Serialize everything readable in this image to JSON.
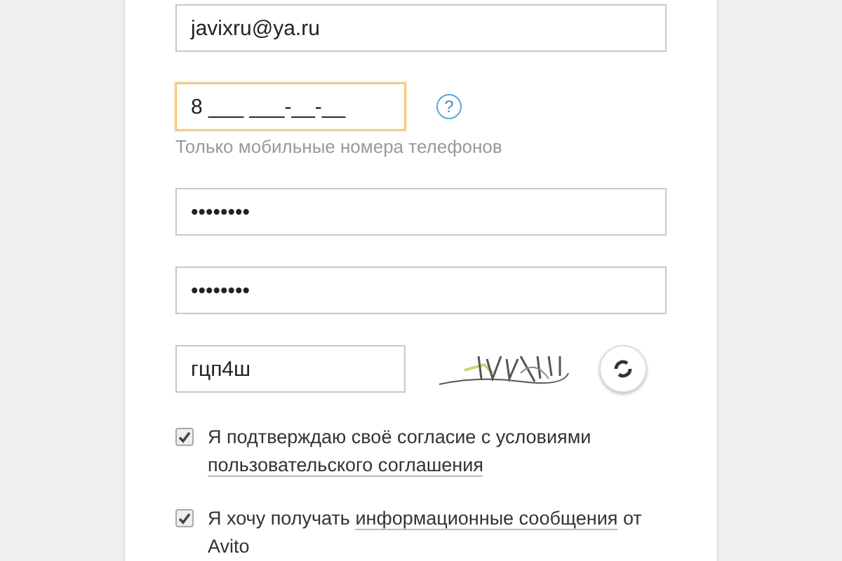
{
  "fields": [
    {
      "kind": "text",
      "value": "javixru@ya.ru",
      "focused": false
    },
    {
      "kind": "phone",
      "value": "8 ___ ___-__-__",
      "focused": true,
      "help": "?",
      "hint": "Только мобильные номера телефонов"
    },
    {
      "kind": "text",
      "value": "••••••••",
      "focused": false
    },
    {
      "kind": "text",
      "value": "••••••••",
      "focused": false
    }
  ],
  "captcha": {
    "value": "гцп4ш"
  },
  "agreements": [
    {
      "checked": true,
      "parts": [
        {
          "text": "Я подтверждаю своё согласие с условиями ",
          "link": false
        },
        {
          "text": "пользовательского соглашения",
          "link": true
        }
      ]
    },
    {
      "checked": true,
      "parts": [
        {
          "text": "Я хочу получать ",
          "link": false
        },
        {
          "text": "информационные сообщения",
          "link": true
        },
        {
          "text": " от Avito",
          "link": false
        }
      ]
    }
  ]
}
